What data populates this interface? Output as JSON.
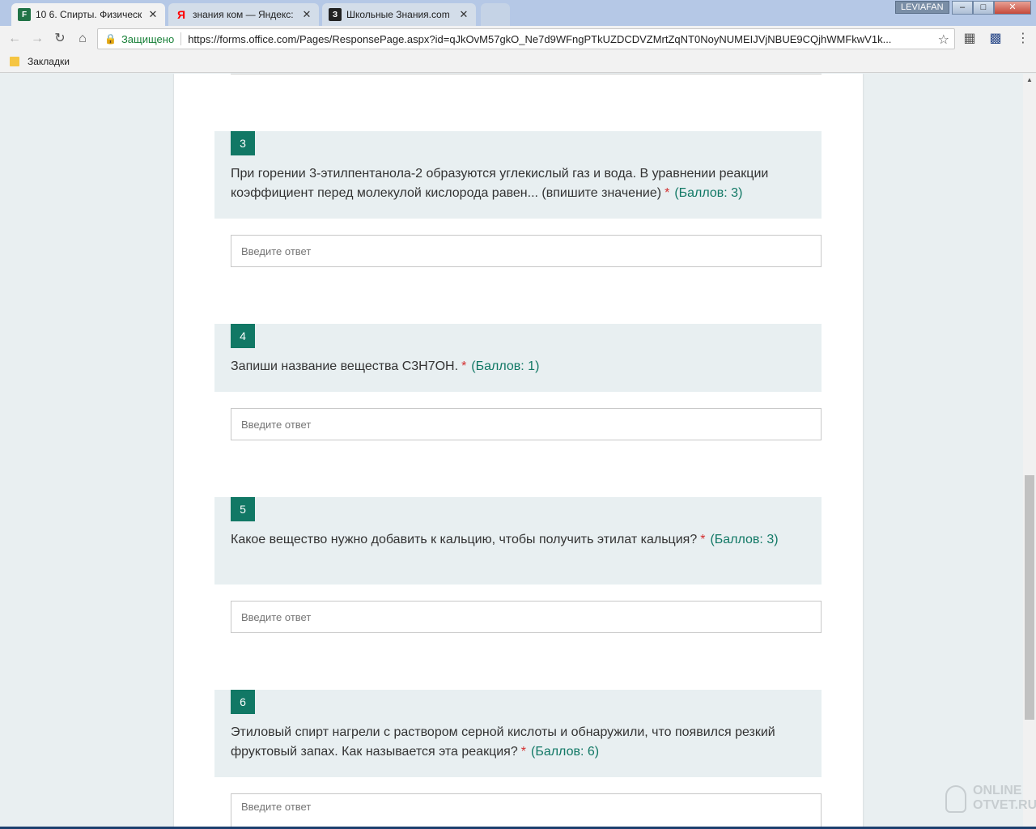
{
  "browser": {
    "tabs": [
      {
        "title": "10 6. Спирты. Физическ",
        "favicon": "forms-icon",
        "favicon_color": "#217346",
        "glyph": "F"
      },
      {
        "title": "знания ком — Яндекс: н",
        "favicon": "yandex-icon",
        "favicon_color": "#ff0000",
        "glyph": "Я"
      },
      {
        "title": "Школьные Знания.com",
        "favicon": "znanija-icon",
        "favicon_color": "#222222",
        "glyph": "З"
      }
    ],
    "close_glyph": "✕",
    "user": "LEVIAFAN",
    "secure_label": "Защищено",
    "url": "https://forms.office.com/Pages/ResponsePage.aspx?id=qJkOvM57gkO_Ne7d9WFngPTkUZDCDVZMrtZqNT0NoyNUMEIJVjNBUE9CQjhWMFkwV1k...",
    "bookmarks_label": "Закладки"
  },
  "theme": {
    "accent": "#117865",
    "question_bg": "#e8eff1",
    "required": "#d32f2f"
  },
  "form": {
    "placeholder": "Введите ответ",
    "questions": [
      {
        "number": "3",
        "text": "При горении 3-этилпентанола-2 образуются углекислый газ и вода. В уравнении реакции коэффициент перед молекулой кислорода равен... (впишите значение)",
        "required": "*",
        "points": "(Баллов: 3)"
      },
      {
        "number": "4",
        "text": "Запиши название вещества  C3H7OH.",
        "required": "*",
        "points": "(Баллов: 1)"
      },
      {
        "number": "5",
        "text": "Какое вещество нужно добавить к кальцию, чтобы получить этилат кальция?",
        "required": "*",
        "points": "(Баллов: 3)"
      },
      {
        "number": "6",
        "text": "Этиловый спирт нагрели с раствором серной кислоты и обнаружили, что появился резкий фруктовый запах. Как называется эта реакция?",
        "required": "*",
        "points": "(Баллов: 6)"
      }
    ]
  },
  "watermark": {
    "line1": "ONLINE",
    "line2": "OTVET.RU"
  }
}
